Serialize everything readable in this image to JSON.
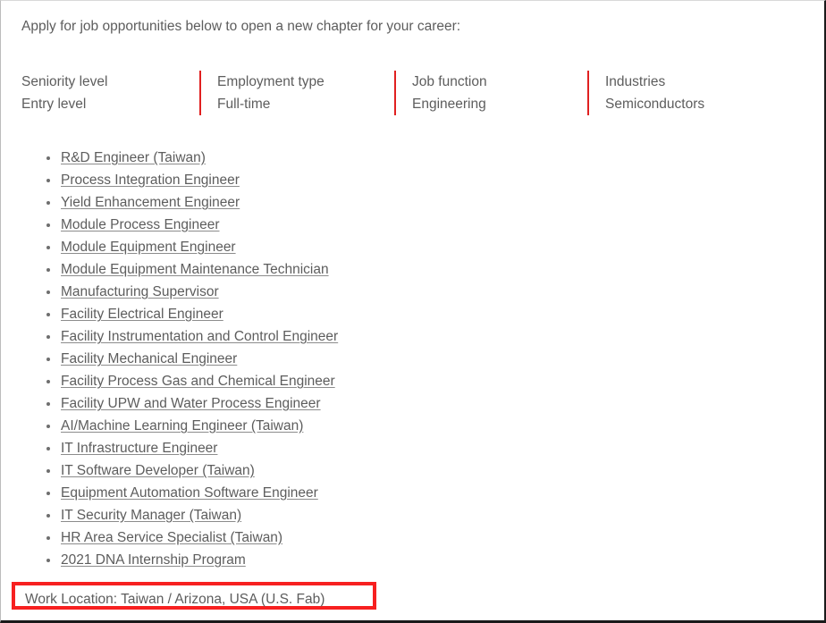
{
  "intro": {
    "text": "Apply for job opportunities below to open a new chapter for your career:"
  },
  "facets": [
    {
      "label": "Seniority level",
      "value": "Entry level"
    },
    {
      "label": "Employment type",
      "value": "Full-time"
    },
    {
      "label": "Job function",
      "value": "Engineering"
    },
    {
      "label": "Industries",
      "value": "Semiconductors"
    }
  ],
  "jobs": [
    {
      "title": "R&D Engineer (Taiwan)"
    },
    {
      "title": "Process Integration Engineer"
    },
    {
      "title": "Yield Enhancement Engineer"
    },
    {
      "title": "Module Process Engineer"
    },
    {
      "title": "Module Equipment Engineer"
    },
    {
      "title": "Module Equipment Maintenance Technician"
    },
    {
      "title": "Manufacturing Supervisor"
    },
    {
      "title": "Facility Electrical Engineer"
    },
    {
      "title": "Facility Instrumentation and Control Engineer"
    },
    {
      "title": "Facility Mechanical Engineer"
    },
    {
      "title": "Facility Process Gas and Chemical Engineer"
    },
    {
      "title": "Facility UPW and Water Process Engineer"
    },
    {
      "title": "AI/Machine Learning Engineer (Taiwan)"
    },
    {
      "title": "IT Infrastructure Engineer"
    },
    {
      "title": "IT Software Developer (Taiwan)"
    },
    {
      "title": "Equipment Automation Software Engineer"
    },
    {
      "title": "IT Security Manager (Taiwan)"
    },
    {
      "title": "HR Area Service Specialist (Taiwan)"
    },
    {
      "title": "2021 DNA Internship Program"
    }
  ],
  "work_location": {
    "text": "Work Location: Taiwan / Arizona, USA (U.S. Fab)"
  },
  "colors": {
    "text": "#5d5d5d",
    "link_underline": "#8c8c8c",
    "facet_divider": "#e02020",
    "highlight_box": "#f72020",
    "background": "#ffffff"
  }
}
